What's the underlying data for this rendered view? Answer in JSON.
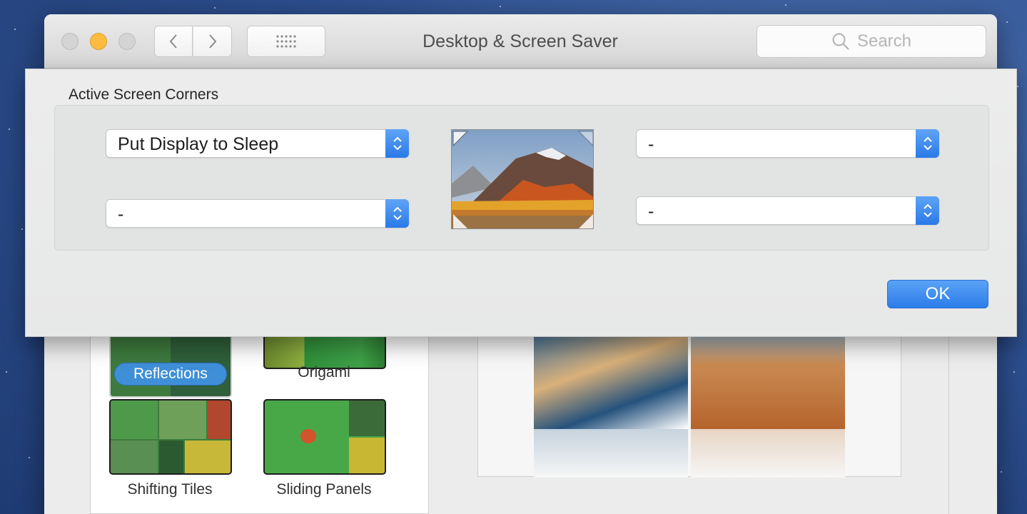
{
  "window": {
    "title": "Desktop & Screen Saver",
    "search_placeholder": "Search"
  },
  "sheet": {
    "title": "Active Screen Corners",
    "top_left": "Put Display to Sleep",
    "bottom_left": "-",
    "top_right": "-",
    "bottom_right": "-",
    "ok_label": "OK"
  },
  "screen_savers": {
    "selected": "Reflections",
    "items": [
      {
        "label": "Reflections"
      },
      {
        "label": "Origami"
      },
      {
        "label": "Shifting Tiles"
      },
      {
        "label": "Sliding Panels"
      }
    ]
  },
  "colors": {
    "accent": "#3f8fd8",
    "minimize": "#fdbc40"
  }
}
